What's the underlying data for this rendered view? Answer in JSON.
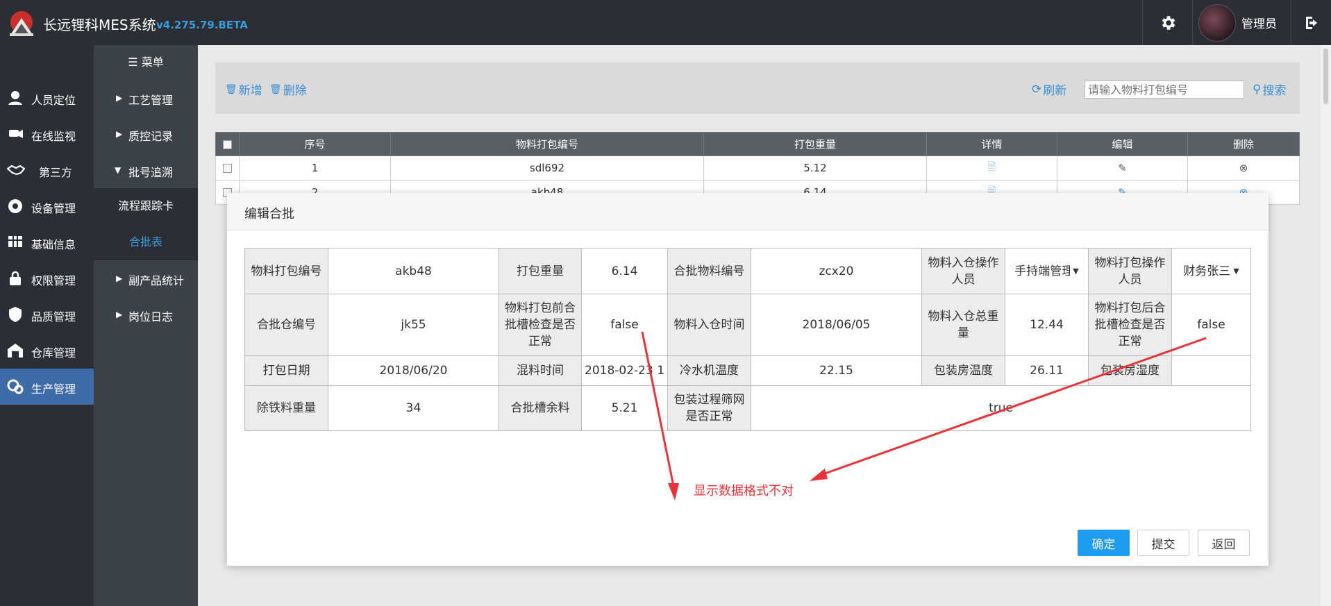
{
  "header": {
    "app_title": "长远锂科MES系统",
    "version": "v4.275.79.BETA",
    "user_name": "管理员",
    "icons": [
      "logo-icon",
      "gear-icon",
      "exit-icon"
    ]
  },
  "sidebar": {
    "items": [
      {
        "label": "人员定位",
        "icon": "location-person-icon"
      },
      {
        "label": "在线监视",
        "icon": "camera-icon"
      },
      {
        "label": "第三方",
        "icon": "handshake-icon"
      },
      {
        "label": "设备管理",
        "icon": "device-icon"
      },
      {
        "label": "基础信息",
        "icon": "table-icon"
      },
      {
        "label": "权限管理",
        "icon": "lock-icon"
      },
      {
        "label": "品质管理",
        "icon": "shield-icon"
      },
      {
        "label": "仓库管理",
        "icon": "warehouse-icon"
      },
      {
        "label": "生产管理",
        "icon": "gears-icon",
        "active": true
      }
    ]
  },
  "submenu": {
    "title": "菜单",
    "items": [
      {
        "label": "工艺管理"
      },
      {
        "label": "质控记录"
      },
      {
        "label": "批号追溯",
        "expanded": true
      },
      {
        "label": "流程跟踪卡",
        "sub": true
      },
      {
        "label": "合批表",
        "sub": true,
        "active": true
      },
      {
        "label": "副产品统计"
      },
      {
        "label": "岗位日志"
      }
    ]
  },
  "toolbar": {
    "add_label": "新增",
    "delete_label": "删除",
    "refresh_label": "刷新",
    "search_placeholder": "请输入物料打包编号",
    "search_label": "搜索"
  },
  "grid": {
    "columns": [
      "序号",
      "物料打包编号",
      "打包重量",
      "详情",
      "编辑",
      "删除"
    ],
    "rows": [
      {
        "index": "1",
        "code": "sdl692",
        "weight": "5.12"
      },
      {
        "index": "2",
        "code": "akb48",
        "weight": "6.14"
      }
    ]
  },
  "modal": {
    "title": "编辑合批",
    "fields": {
      "r1": [
        "物料打包编号",
        "akb48",
        "打包重量",
        "6.14",
        "合批物料编号",
        "zcx20",
        "物料入仓操作人员",
        "手持端管理",
        "物料打包操作人员",
        "财务张三"
      ],
      "r2": [
        "合批仓编号",
        "jk55",
        "物料打包前合批槽检查是否正常",
        "false",
        "物料入仓时间",
        "2018/06/05",
        "物料入仓总重量",
        "12.44",
        "物料打包后合批槽检查是否正常",
        "false"
      ],
      "r3": [
        "打包日期",
        "2018/06/20",
        "混料时间",
        "2018-02-23 1",
        "冷水机温度",
        "22.15",
        "包装房温度",
        "26.11",
        "包装房湿度",
        ""
      ],
      "r4": [
        "除铁料重量",
        "34",
        "合批槽余料",
        "5.21",
        "包装过程筛网是否正常",
        "true"
      ]
    },
    "buttons": {
      "confirm": "确定",
      "submit": "提交",
      "back": "返回"
    }
  },
  "annotation": {
    "text": "显示数据格式不对",
    "color": "#e8333a"
  },
  "colors": {
    "topbar": "#2b2f35",
    "active_nav": "#3f6aa8",
    "accent": "#3a9bd8",
    "primary_button": "#1f9bf0"
  }
}
